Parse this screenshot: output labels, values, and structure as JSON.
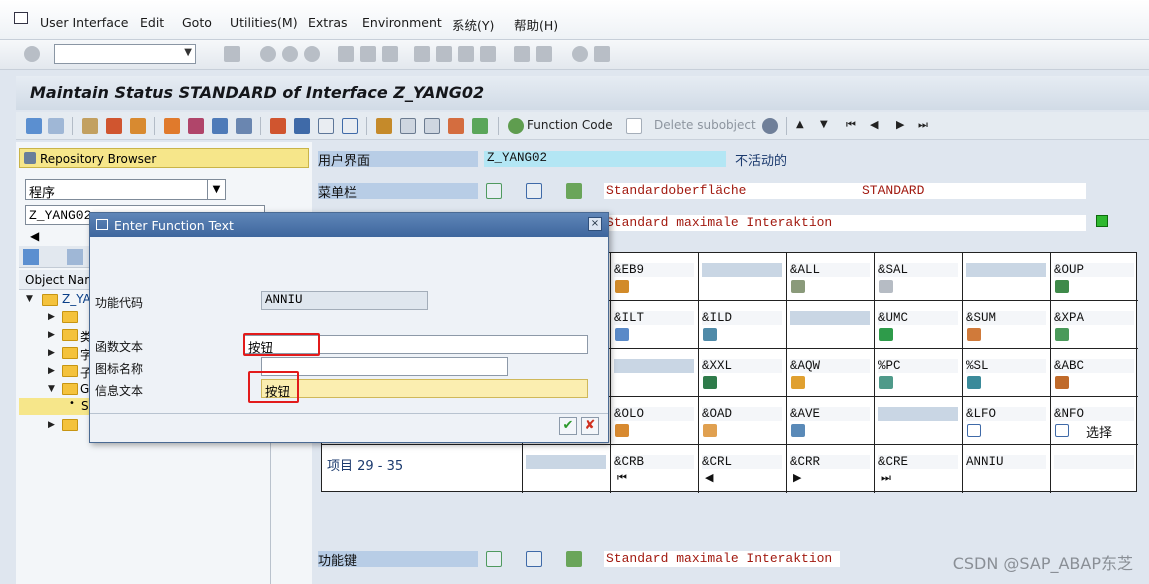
{
  "menu": {
    "items": [
      "User Interface",
      "Edit",
      "Goto",
      "Utilities(M)",
      "Extras",
      "Environment",
      "系统(Y)",
      "帮助(H)"
    ]
  },
  "title": "Maintain Status STANDARD of Interface Z_YANG02",
  "app_toolbar": {
    "function_code": "Function Code",
    "delete_subobject": "Delete subobject"
  },
  "left": {
    "repository_browser": "Repository Browser",
    "object_type": "程序",
    "object_name": "Z_YANG02",
    "column_header": "Object Nam",
    "tree_root": "Z_YAN",
    "tree_fragments": [
      "类",
      "字",
      "子",
      "G",
      "S"
    ]
  },
  "right": {
    "user_interface_label": "用户界面",
    "user_interface_value": "Z_YANG02",
    "inactive": "不活动的",
    "menu_bar_label": "菜单栏",
    "menu_bar_text": "Standardoberfläche",
    "menu_bar_status": "STANDARD",
    "app_toolbar_text": "Standard maximale Interaktion",
    "items_range": "项目 29 - 35",
    "function_keys_label": "功能键",
    "function_keys_text": "Standard maximale Interaktion",
    "select_text": "选择"
  },
  "grid": {
    "rows": [
      [
        "",
        "&EB9",
        "",
        "&ALL",
        "&SAL",
        "",
        "&OUP"
      ],
      [
        "",
        "&ILT",
        "&ILD",
        "",
        "&UMC",
        "&SUM",
        "&XPA"
      ],
      [
        "",
        "",
        "&XXL",
        "&AQW",
        "%PC",
        "%SL",
        "&ABC"
      ],
      [
        "",
        "&OLO",
        "&OAD",
        "&AVE",
        "",
        "&LFO",
        "&NFO"
      ],
      [
        "",
        "&CRB",
        "&CRL",
        "&CRR",
        "&CRE",
        "ANNIU",
        ""
      ]
    ]
  },
  "dialog": {
    "title": "Enter Function Text",
    "function_code_label": "功能代码",
    "function_code_value": "ANNIU",
    "function_text_label": "函数文本",
    "function_text_value": "按钮",
    "icon_name_label": "图标名称",
    "icon_name_value": "",
    "info_text_label": "信息文本",
    "info_text_value": "按钮",
    "close_glyph": "×",
    "ok_glyph": "✔",
    "cancel_glyph": "✘"
  },
  "watermark": "CSDN @SAP_ABAP东芝",
  "colors": {
    "selection_yellow": "#f6e68a",
    "label_blue": "#b8cde6",
    "status_green": "#2fb82f",
    "highlight_red": "#e21b1b"
  }
}
